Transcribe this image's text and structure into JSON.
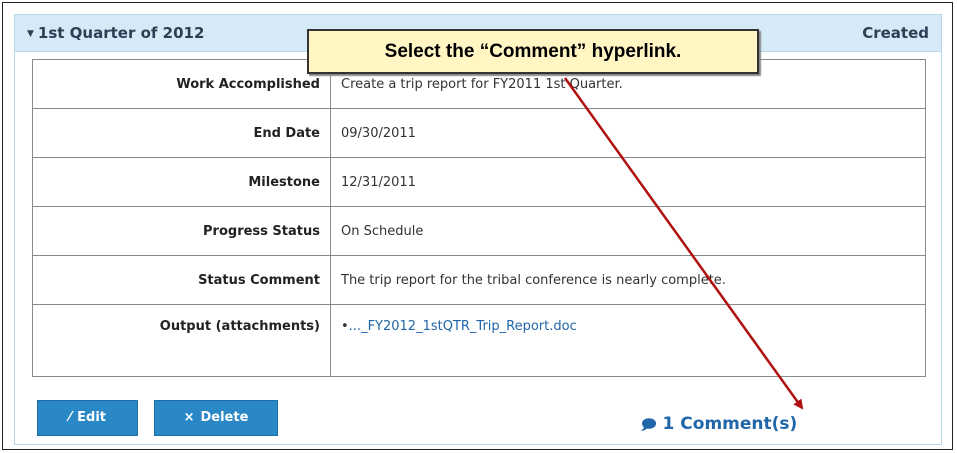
{
  "panel": {
    "title": "1st Quarter of 2012",
    "status": "Created"
  },
  "rows": [
    {
      "label": "Work Accomplished",
      "value": "Create a trip report for FY2011 1st Quarter."
    },
    {
      "label": "End Date",
      "value": "09/30/2011"
    },
    {
      "label": "Milestone",
      "value": "12/31/2011"
    },
    {
      "label": "Progress Status",
      "value": "On Schedule"
    },
    {
      "label": "Status Comment",
      "value": "The trip report for the tribal conference is nearly complete."
    },
    {
      "label": "Output (attachments)",
      "value": "..._FY2012_1stQTR_Trip_Report.doc"
    }
  ],
  "buttons": {
    "edit": "Edit",
    "delete": "Delete"
  },
  "comments_link": "1 Comment(s)",
  "callout": "Select the “Comment” hyperlink.",
  "icons": {
    "collapse": "triangle-down-icon",
    "edit": "pencil-icon",
    "delete": "x-icon",
    "comment": "speech-bubble-icon"
  },
  "colors": {
    "header_bg": "#d5e9f7",
    "button_bg": "#2b88c7",
    "link": "#2266aa",
    "callout_bg": "#fff6c4",
    "arrow": "#b01010"
  }
}
